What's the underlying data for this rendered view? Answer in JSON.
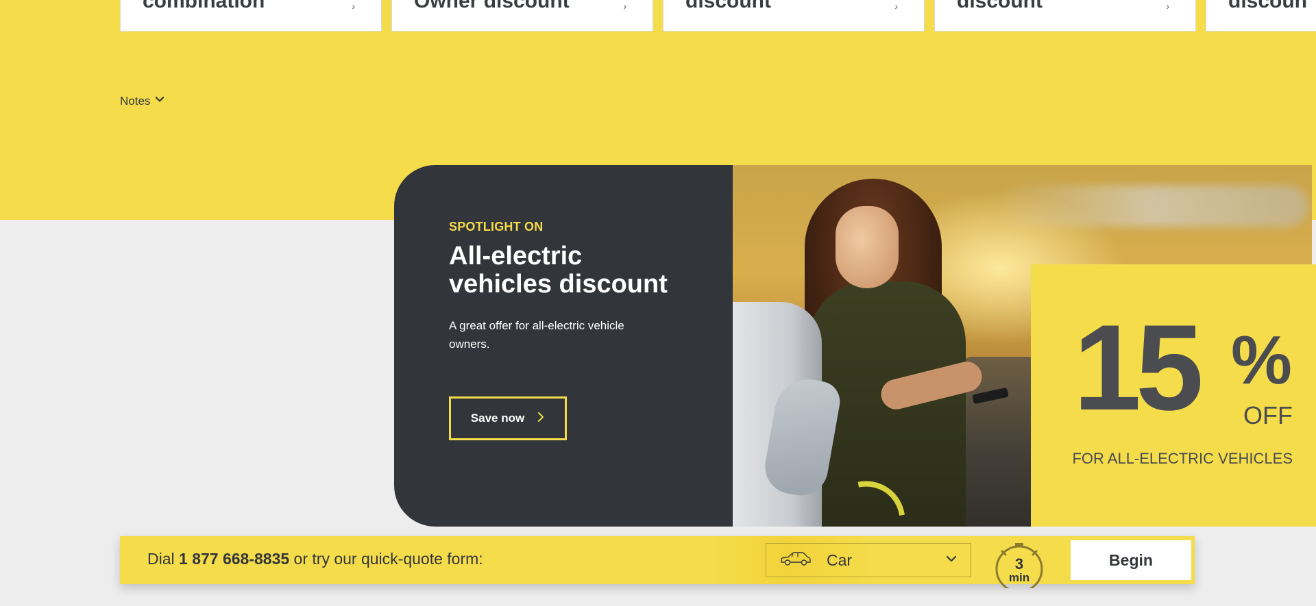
{
  "cards": [
    {
      "title": "combination",
      "chevron": "›"
    },
    {
      "title": "Owner discount",
      "chevron": "›"
    },
    {
      "title": "discount",
      "chevron": "›"
    },
    {
      "title": "discount",
      "chevron": "›"
    },
    {
      "title": "discoun",
      "chevron": ""
    }
  ],
  "notes": {
    "label": "Notes",
    "icon": "chevron-down-icon"
  },
  "spotlight": {
    "eyebrow": "SPOTLIGHT ON",
    "title": "All-electric vehicles discount",
    "description": "A great offer for all-electric vehicle owners.",
    "button_label": "Save now",
    "badge": {
      "number": "15",
      "percent": "%",
      "off": "OFF",
      "subtitle": "FOR ALL-ELECTRIC VEHICLES"
    }
  },
  "quote_bar": {
    "prefix": "Dial ",
    "phone": "1 877 668-8835",
    "suffix": " or try our quick-quote form:",
    "vehicle_select": {
      "selected": "Car",
      "icon": "car-icon"
    },
    "timer": {
      "number": "3",
      "unit": "min"
    },
    "begin_label": "Begin"
  },
  "colors": {
    "brand_yellow": "#f5dc4a",
    "dark": "#32353a",
    "background": "#ededed"
  }
}
